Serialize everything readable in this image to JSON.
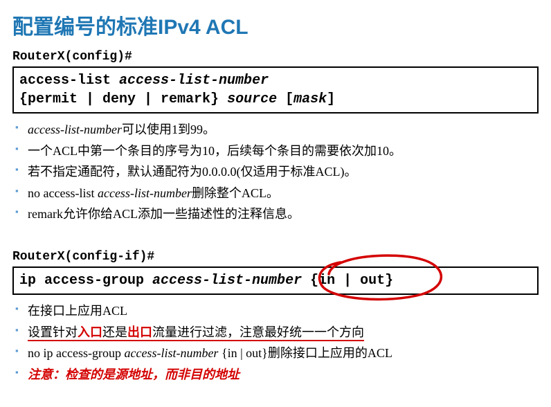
{
  "title": "配置编号的标准IPv4 ACL",
  "block1": {
    "prompt": "RouterX(config)#",
    "syntax_kw1": "access-list ",
    "syntax_arg1": "access-list-number",
    "syntax_kw2": "{permit | deny | remark} ",
    "syntax_arg2": "source",
    "syntax_kw3": " [",
    "syntax_arg3": "mask",
    "syntax_kw4": "]"
  },
  "bullets1": {
    "b1_arg": "access-list-number",
    "b1_rest": "可以使用1到99。",
    "b2": "一个ACL中第一个条目的序号为10，后续每个条目的需要依次加10。",
    "b3": "若不指定通配符，默认通配符为0.0.0.0(仅适用于标准ACL)。",
    "b4_pre": "no access-list ",
    "b4_arg": "access-list-number",
    "b4_rest": "删除整个ACL。",
    "b5": "remark允许你给ACL添加一些描述性的注释信息。"
  },
  "block2": {
    "prompt": "RouterX(config-if)#",
    "syntax_kw1": "ip access-group ",
    "syntax_arg1": "access-list-number",
    "syntax_kw2": " {in | out}"
  },
  "bullets2": {
    "b1": "在接口上应用ACL",
    "b2_pre": "设置针对",
    "b2_red1": "入口",
    "b2_mid": "还是",
    "b2_red2": "出口",
    "b2_rest": "流量进行过滤，注意最好统一一个方向",
    "b3_pre": "no ip access-group ",
    "b3_arg": "access-list-number ",
    "b3_rest": "{in | out}删除接口上应用的ACL",
    "b4": "注意：检查的是源地址，而非目的地址"
  }
}
